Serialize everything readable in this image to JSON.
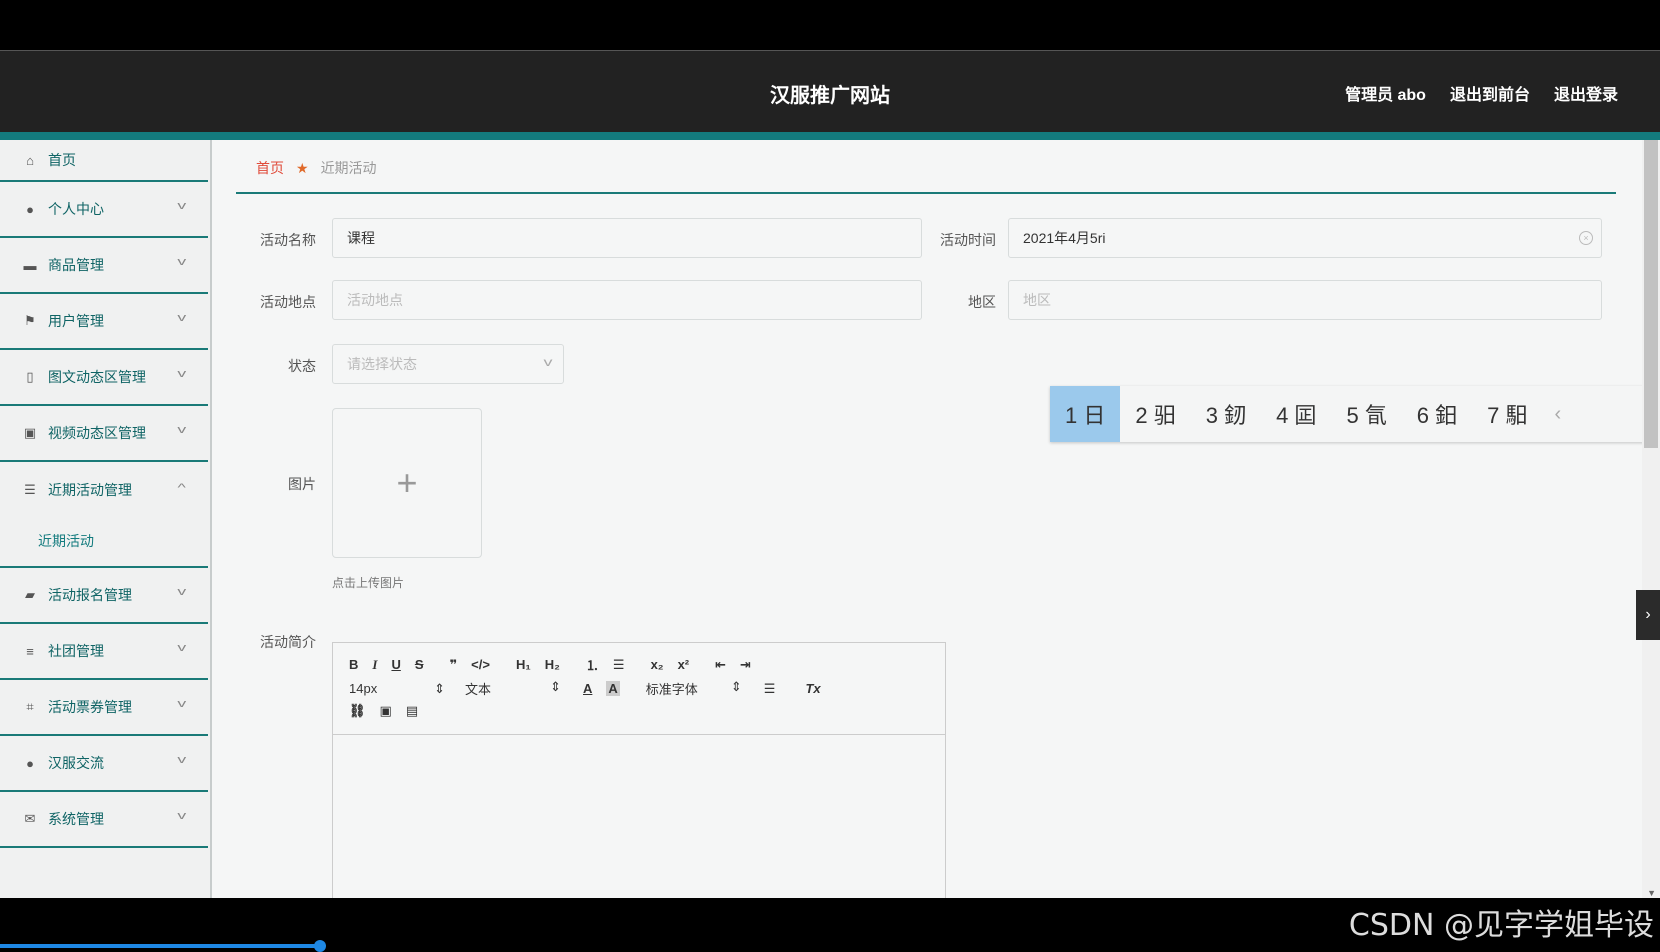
{
  "header": {
    "title": "汉服推广网站",
    "user_label": "管理员 abo",
    "to_front_label": "退出到前台",
    "logout_label": "退出登录"
  },
  "sidebar": {
    "items": [
      {
        "label": "首页",
        "icon": "home-icon"
      },
      {
        "label": "个人中心",
        "icon": "user-icon"
      },
      {
        "label": "商品管理",
        "icon": "goods-icon"
      },
      {
        "label": "用户管理",
        "icon": "flag-icon"
      },
      {
        "label": "图文动态区管理",
        "icon": "image-icon"
      },
      {
        "label": "视频动态区管理",
        "icon": "video-icon"
      },
      {
        "label": "近期活动管理",
        "icon": "list-icon"
      },
      {
        "label": "活动报名管理",
        "icon": "chat-icon"
      },
      {
        "label": "社团管理",
        "icon": "sliders-icon"
      },
      {
        "label": "活动票券管理",
        "icon": "crop-icon"
      },
      {
        "label": "汉服交流",
        "icon": "user-icon"
      },
      {
        "label": "系统管理",
        "icon": "mail-icon"
      }
    ],
    "sub_item": "近期活动"
  },
  "breadcrumb": {
    "home": "首页",
    "current": "近期活动"
  },
  "form": {
    "name_label": "活动名称",
    "name_value": "课程",
    "time_label": "活动时间",
    "time_value": "2021年4月5ri",
    "place_label": "活动地点",
    "place_placeholder": "活动地点",
    "region_label": "地区",
    "region_placeholder": "地区",
    "status_label": "状态",
    "status_placeholder": "请选择状态",
    "image_label": "图片",
    "upload_tip": "点击上传图片",
    "intro_label": "活动简介"
  },
  "editor": {
    "font_size": "14px",
    "block_type": "文本",
    "font_family": "标准字体"
  },
  "ime": {
    "candidates": [
      "1 日",
      "2 驲",
      "3 釰",
      "4 囸",
      "5 氜",
      "6 鈤",
      "7 馹"
    ]
  },
  "watermark": "CSDN @见字学姐毕设",
  "colors": {
    "accent": "#137b7e",
    "header_bg": "#222222",
    "breadcrumb_home": "#e04b3a"
  }
}
